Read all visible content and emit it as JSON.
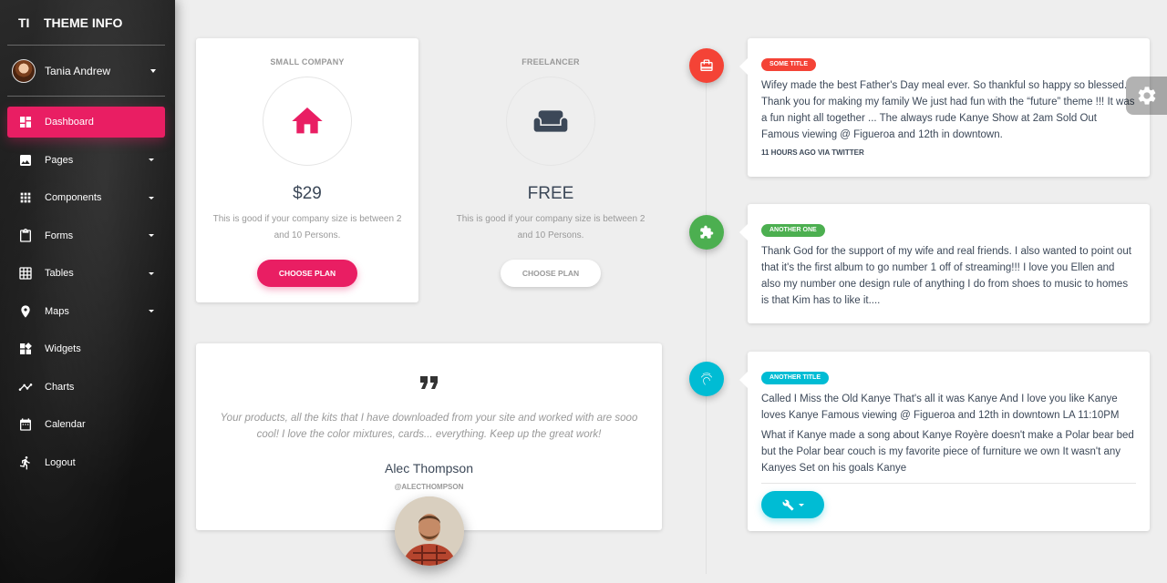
{
  "logo": {
    "mini": "TI",
    "normal": "THEME INFO"
  },
  "user": {
    "name": "Tania Andrew"
  },
  "nav": [
    {
      "label": "Dashboard",
      "icon": "dashboard-icon",
      "active": true
    },
    {
      "label": "Pages",
      "icon": "image-icon",
      "caret": true
    },
    {
      "label": "Components",
      "icon": "apps-icon",
      "caret": true
    },
    {
      "label": "Forms",
      "icon": "content-paste-icon",
      "caret": true
    },
    {
      "label": "Tables",
      "icon": "grid-on-icon",
      "caret": true
    },
    {
      "label": "Maps",
      "icon": "place-icon",
      "caret": true
    },
    {
      "label": "Widgets",
      "icon": "widgets-icon"
    },
    {
      "label": "Charts",
      "icon": "timeline-icon"
    },
    {
      "label": "Calendar",
      "icon": "date-range-icon"
    },
    {
      "label": "Logout",
      "icon": "directions-run-icon"
    }
  ],
  "pricing": [
    {
      "category": "SMALL COMPANY",
      "icon": "home-icon",
      "price": "$29",
      "description": "This is good if your company size is between 2 and 10 Persons.",
      "button": "CHOOSE PLAN"
    },
    {
      "category": "FREELANCER",
      "icon": "weekend-icon",
      "price": "FREE",
      "description": "This is good if your company size is between 2 and 10 Persons.",
      "button": "CHOOSE PLAN"
    }
  ],
  "testimonial": {
    "quote_icon": "format-quote-icon",
    "text": "Your products, all the kits that I have downloaded from your site and worked with are sooo cool! I love the color mixtures, cards... everything. Keep up the great work!",
    "name": "Alec Thompson",
    "handle": "@ALECTHOMPSON"
  },
  "timeline": [
    {
      "badge_icon": "card-travel-icon",
      "label": "SOME TITLE",
      "color": "#f44336",
      "body": "Wifey made the best Father's Day meal ever. So thankful so happy so blessed. Thank you for making my family We just had fun with the “future” theme !!! It was a fun night all together ... The always rude Kanye Show at 2am Sold Out Famous viewing @ Figueroa and 12th in downtown.",
      "footer": "11 HOURS AGO VIA TWITTER"
    },
    {
      "badge_icon": "extension-icon",
      "label": "ANOTHER ONE",
      "color": "#4caf50",
      "body": "Thank God for the support of my wife and real friends. I also wanted to point out that it's the first album to go number 1 off of streaming!!! I love you Ellen and also my number one design rule of anything I do from shoes to music to homes is that Kim has to like it...."
    },
    {
      "badge_icon": "fingerprint-icon",
      "label": "ANOTHER TITLE",
      "color": "#00bcd4",
      "body": "Called I Miss the Old Kanye That's all it was Kanye And I love you like Kanye loves Kanye Famous viewing @ Figueroa and 12th in downtown LA 11:10PM",
      "body2": "What if Kanye made a song about Kanye Royère doesn't make a Polar bear bed but the Polar bear couch is my favorite piece of furniture we own It wasn't any Kanyes Set on his goals Kanye",
      "button_icon": "build-icon"
    }
  ],
  "colors": {
    "primary": "#e91e63",
    "danger": "#f44336",
    "success": "#4caf50",
    "info": "#00bcd4"
  },
  "settings_icon": "gear-icon"
}
